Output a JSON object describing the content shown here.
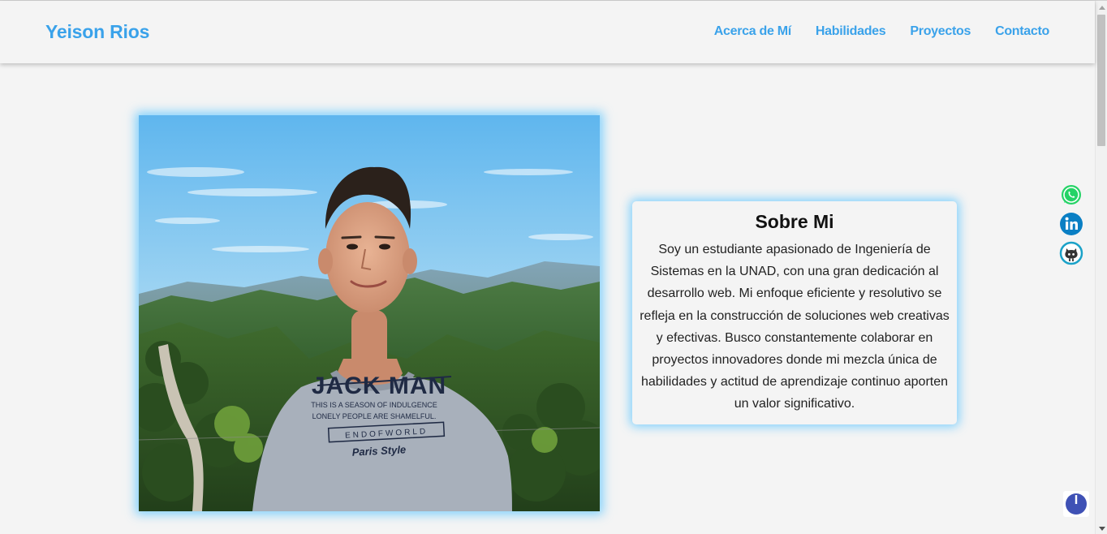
{
  "header": {
    "brand": "Yeison Rios",
    "nav": [
      {
        "label": "Acerca de Mí"
      },
      {
        "label": "Habilidades"
      },
      {
        "label": "Proyectos"
      },
      {
        "label": "Contacto"
      }
    ]
  },
  "photo": {
    "shirt_title": "JACK MAN",
    "shirt_line1": "THIS IS A SEASON OF INDULGENCE",
    "shirt_line2": "LONELY PEOPLE ARE SHAMELFUL.",
    "shirt_line3": "ENDOFWORLD",
    "shirt_line4": "Paris Style"
  },
  "about": {
    "title": "Sobre Mi",
    "text": "Soy un estudiante apasionado de Ingeniería de Sistemas en la UNAD, con una gran dedicación al desarrollo web. Mi enfoque eficiente y resolutivo se refleja en la construcción de soluciones web creativas y efectivas. Busco constantemente colaborar en proyectos innovadores donde mi mezcla única de habilidades y actitud de aprendizaje continuo aporten un valor significativo."
  },
  "social": [
    {
      "icon": "whatsapp-icon",
      "color": "#25d366"
    },
    {
      "icon": "linkedin-icon",
      "color": "#0a7fc4"
    },
    {
      "icon": "github-icon",
      "color": "#1ba2c8"
    }
  ],
  "colors": {
    "accent": "#3aa2ea",
    "glow": "#5cc6ff",
    "power": "#3f51b5"
  }
}
